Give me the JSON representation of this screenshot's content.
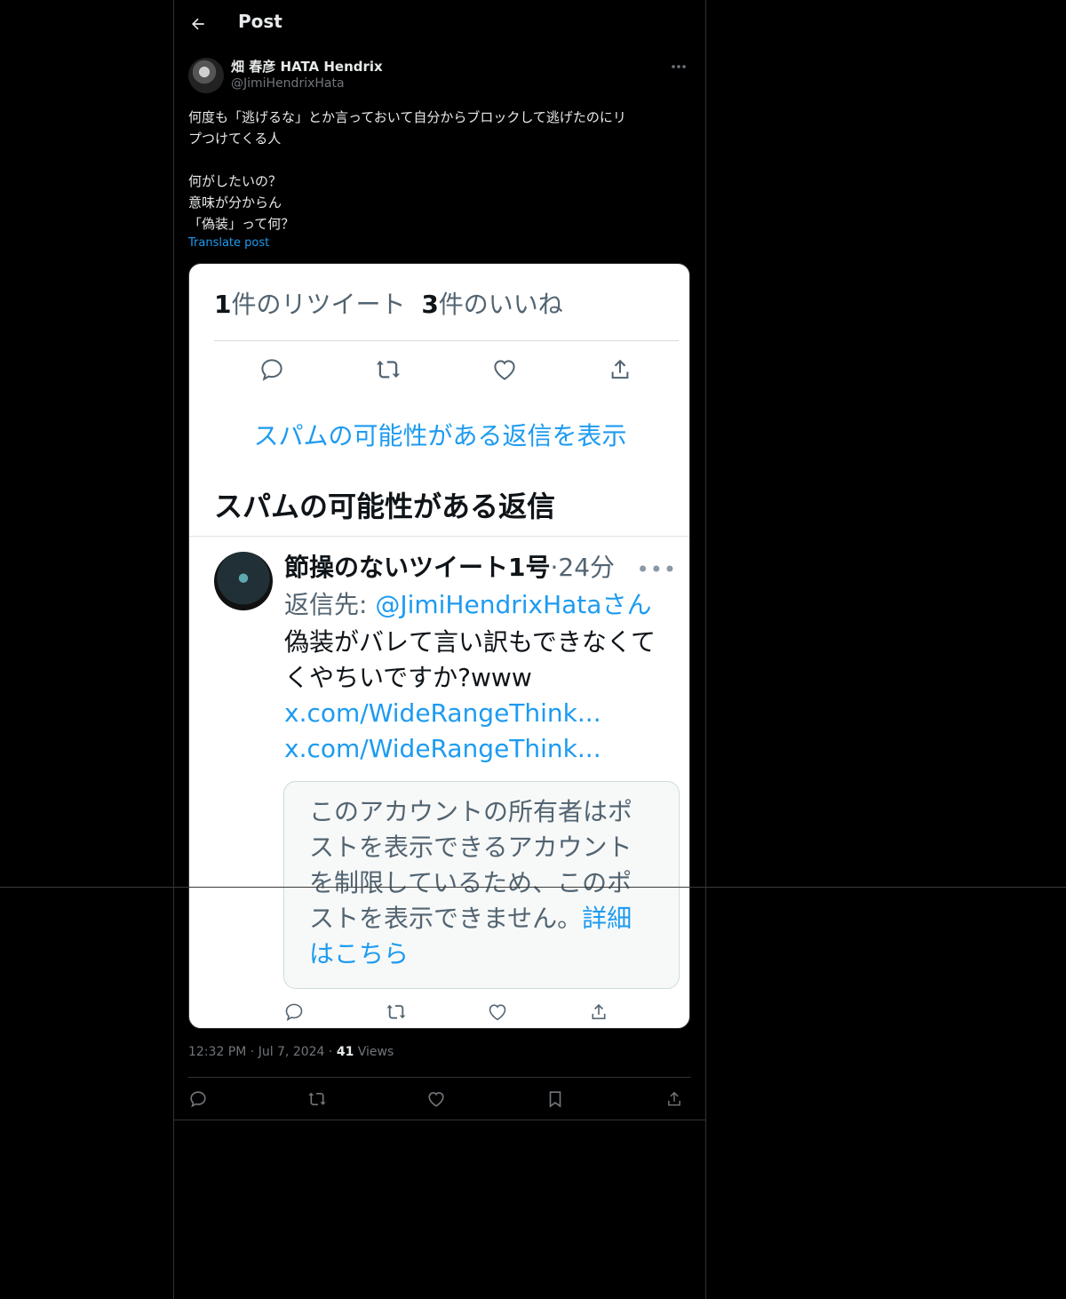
{
  "header": {
    "title": "Post"
  },
  "author": {
    "display_name": "畑 春彦 HATA Hendrix",
    "handle": "@JimiHendrixHata"
  },
  "post": {
    "lines": [
      "何度も「逃げるな」とか言っておいて自分からブロックして逃げたのにリプつけてくる人",
      "",
      "何がしたいの？",
      "意味が分からん",
      "「偽装」って何？"
    ],
    "line1a": "何度も「逃げるな」とか言っておいて自分からブロックして逃げたのにリ",
    "line1b": "プつけてくる人",
    "line2": "何がしたいの？",
    "line3": "意味が分からん",
    "line4": "「偽装」って何？",
    "translate_label": "Translate post"
  },
  "screenshot": {
    "retweet_count": "1",
    "retweet_label": "件のリツイート",
    "like_count": "3",
    "like_label": "件のいいね",
    "show_spam_replies": "スパムの可能性がある返信を表示",
    "spam_heading": "スパムの可能性がある返信",
    "reply_name": "節操のないツイート1号",
    "reply_time": "·24分",
    "reply_to_prefix": "返信先: ",
    "reply_to_mention": "@JimiHendrixHataさん",
    "reply_text": "偽装がバレて言い訳もできなくてくやちいですか?www",
    "reply_link1": "x.com/WideRangeThink...",
    "reply_link2": "x.com/WideRangeThink...",
    "notice_text": "このアカウントの所有者はポストを表示できるアカウントを制限しているため、このポストを表示できません。",
    "notice_link": "詳細はこちら"
  },
  "meta": {
    "time": "12:32 PM",
    "sep": " · ",
    "date": "Jul 7, 2024",
    "views_count": "41",
    "views_label": "Views"
  },
  "icons": {
    "back": "arrow-left-icon",
    "more": "more-horizontal-icon",
    "reply": "reply-icon",
    "retweet": "retweet-icon",
    "like": "heart-icon",
    "bookmark": "bookmark-icon",
    "share": "share-icon"
  },
  "colors": {
    "accent": "#1d9bf0",
    "background": "#000000",
    "text": "#e7e9ea",
    "secondary": "#71767b"
  }
}
